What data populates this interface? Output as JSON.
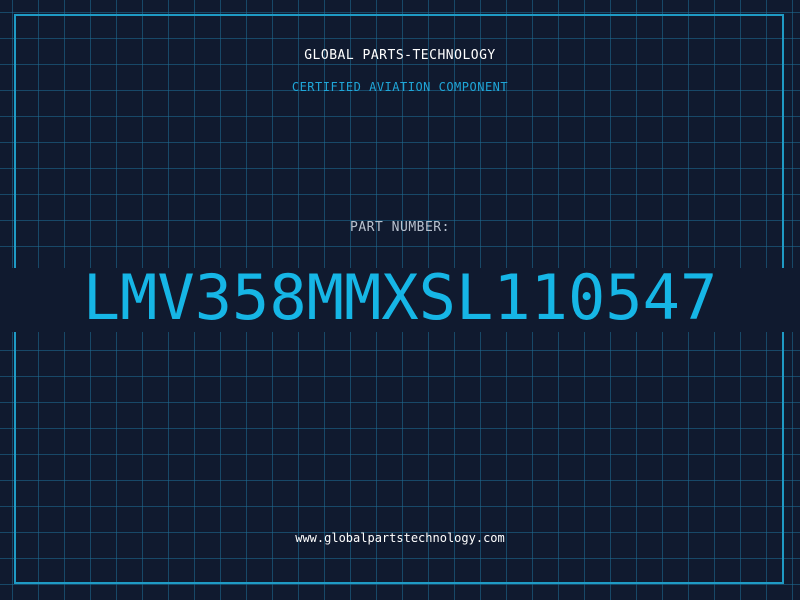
{
  "header": {
    "company": "GLOBAL PARTS-TECHNOLOGY",
    "subtitle": "CERTIFIED AVIATION COMPONENT"
  },
  "part": {
    "label": "PART NUMBER:",
    "number": "LMV358MMXSL110547"
  },
  "footer": {
    "website": "www.globalpartstechnology.com"
  },
  "colors": {
    "background": "#101a2f",
    "grid": "#1e6e96",
    "frame": "#1f9ac4",
    "accent": "#16b6e6",
    "label": "#b9c2cf",
    "text": "#ffffff"
  }
}
